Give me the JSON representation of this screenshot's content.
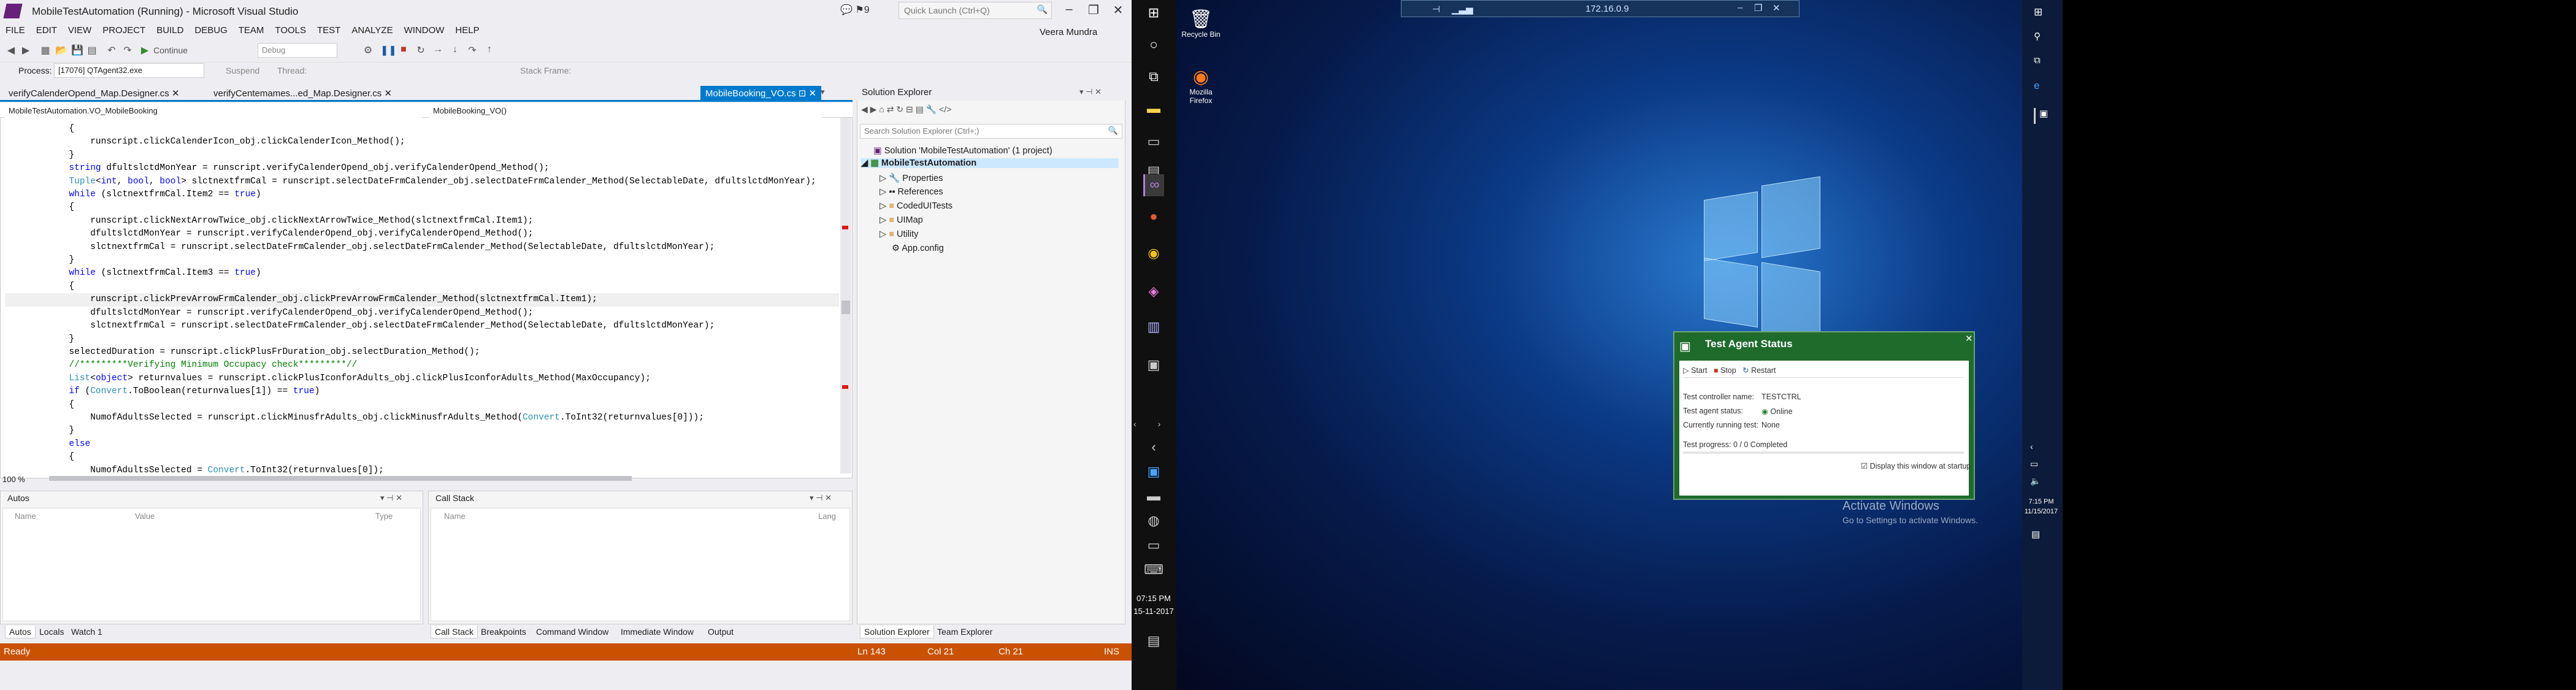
{
  "window": {
    "title": "MobileTestAutomation (Running) - Microsoft Visual Studio",
    "notif_count": "9",
    "quick_launch_placeholder": "Quick Launch (Ctrl+Q)",
    "user": "Veera Mundra"
  },
  "menu": [
    "FILE",
    "EDIT",
    "VIEW",
    "PROJECT",
    "BUILD",
    "DEBUG",
    "TEAM",
    "TOOLS",
    "TEST",
    "ANALYZE",
    "WINDOW",
    "HELP"
  ],
  "toolbar": {
    "continue": "Continue",
    "config": "Debug",
    "suspend": "Suspend",
    "thread": "Thread:",
    "stack_frame": "Stack Frame:",
    "process_label": "Process:",
    "process_value": "[17076] QTAgent32.exe"
  },
  "doc_tabs": [
    {
      "label": "verifyCalenderOpend_Map.Designer.cs"
    },
    {
      "label": "verifyCentemames...ed_Map.Designer.cs"
    },
    {
      "label": "MobileBooking_VO.cs"
    }
  ],
  "nav": {
    "class_combo": "MobileTestAutomation.VO_MobileBooking",
    "member_combo": "MobileBooking_VO()"
  },
  "code_lines": [
    "            {",
    "                runscript.clickCalenderIcon_obj.clickCalenderIcon_Method();",
    "            }",
    "            string dfultslctdMonYear = runscript.verifyCalenderOpend_obj.verifyCalenderOpend_Method();",
    "            Tuple<int, bool, bool> slctnextfrmCal = runscript.selectDateFrmCalender_obj.selectDateFrmCalender_Method(SelectableDate, dfultslctdMonYear);",
    "            while (slctnextfrmCal.Item2 == true)",
    "            {",
    "                runscript.clickNextArrowTwice_obj.clickNextArrowTwice_Method(slctnextfrmCal.Item1);",
    "                dfultslctdMonYear = runscript.verifyCalenderOpend_obj.verifyCalenderOpend_Method();",
    "                slctnextfrmCal = runscript.selectDateFrmCalender_obj.selectDateFrmCalender_Method(SelectableDate, dfultslctdMonYear);",
    "            }",
    "            while (slctnextfrmCal.Item3 == true)",
    "            {",
    "                runscript.clickPrevArrowFrmCalender_obj.clickPrevArrowFrmCalender_Method(slctnextfrmCal.Item1);",
    "                dfultslctdMonYear = runscript.verifyCalenderOpend_obj.verifyCalenderOpend_Method();",
    "                slctnextfrmCal = runscript.selectDateFrmCalender_obj.selectDateFrmCalender_Method(SelectableDate, dfultslctdMonYear);",
    "            }",
    "            selectedDuration = runscript.clickPlusFrDuration_obj.selectDuration_Method();",
    "            //*********Verifying Minimum Occupacy check*********//",
    "            List<object> returnvalues = runscript.clickPlusIconforAdults_obj.clickPlusIconforAdults_Method(MaxOccupancy);",
    "            if (Convert.ToBoolean(returnvalues[1]) == true)",
    "            {",
    "                NumofAdultsSelected = runscript.clickMinusfrAdults_obj.clickMinusfrAdults_Method(Convert.ToInt32(returnvalues[0]));",
    "            }",
    "            else",
    "            {",
    "                NumofAdultsSelected = Convert.ToInt32(returnvalues[0]);"
  ],
  "zoom": "100 %",
  "autos": {
    "title": "Autos",
    "cols": [
      "Name",
      "Value",
      "Type"
    ]
  },
  "callstack": {
    "title": "Call Stack",
    "cols": [
      "Name",
      "Lang"
    ]
  },
  "left_bottom_tabs": [
    "Autos",
    "Locals",
    "Watch 1"
  ],
  "right_bottom_tabs": [
    "Call Stack",
    "Breakpoints",
    "Command Window",
    "Immediate Window",
    "Output"
  ],
  "solution_explorer": {
    "title": "Solution Explorer",
    "search_placeholder": "Search Solution Explorer (Ctrl+;)",
    "solution": "Solution 'MobileTestAutomation' (1 project)",
    "project": "MobileTestAutomation",
    "items": [
      "Properties",
      "References",
      "CodedUITests",
      "UIMap",
      "Utility",
      "App.config"
    ]
  },
  "se_bottom_tabs": [
    "Solution Explorer",
    "Team Explorer"
  ],
  "status": {
    "ready": "Ready",
    "ln": "Ln 143",
    "col": "Col 21",
    "ch": "Ch 21",
    "ins": "INS"
  },
  "taskbar": {
    "time": "07:15 PM",
    "date": "15-11-2017"
  },
  "rdp": {
    "address": "172.16.0.9"
  },
  "desktop": {
    "recycle_bin": "Recycle Bin",
    "firefox": "Mozilla Firefox",
    "watermark_title": "Activate Windows",
    "watermark_sub": "Go to Settings to activate Windows."
  },
  "agent": {
    "title": "Test Agent Status",
    "start": "Start",
    "stop": "Stop",
    "restart": "Restart",
    "controller_label": "Test controller name:",
    "controller": "TESTCTRL",
    "status_label": "Test agent status:",
    "status": "Online",
    "running_label": "Currently running test:",
    "running": "None",
    "progress_label": "Test progress:",
    "progress": "0 / 0 Completed",
    "startup_label": "Display this window at startup"
  },
  "remote_clock": {
    "time": "7:15 PM",
    "date": "11/15/2017"
  }
}
